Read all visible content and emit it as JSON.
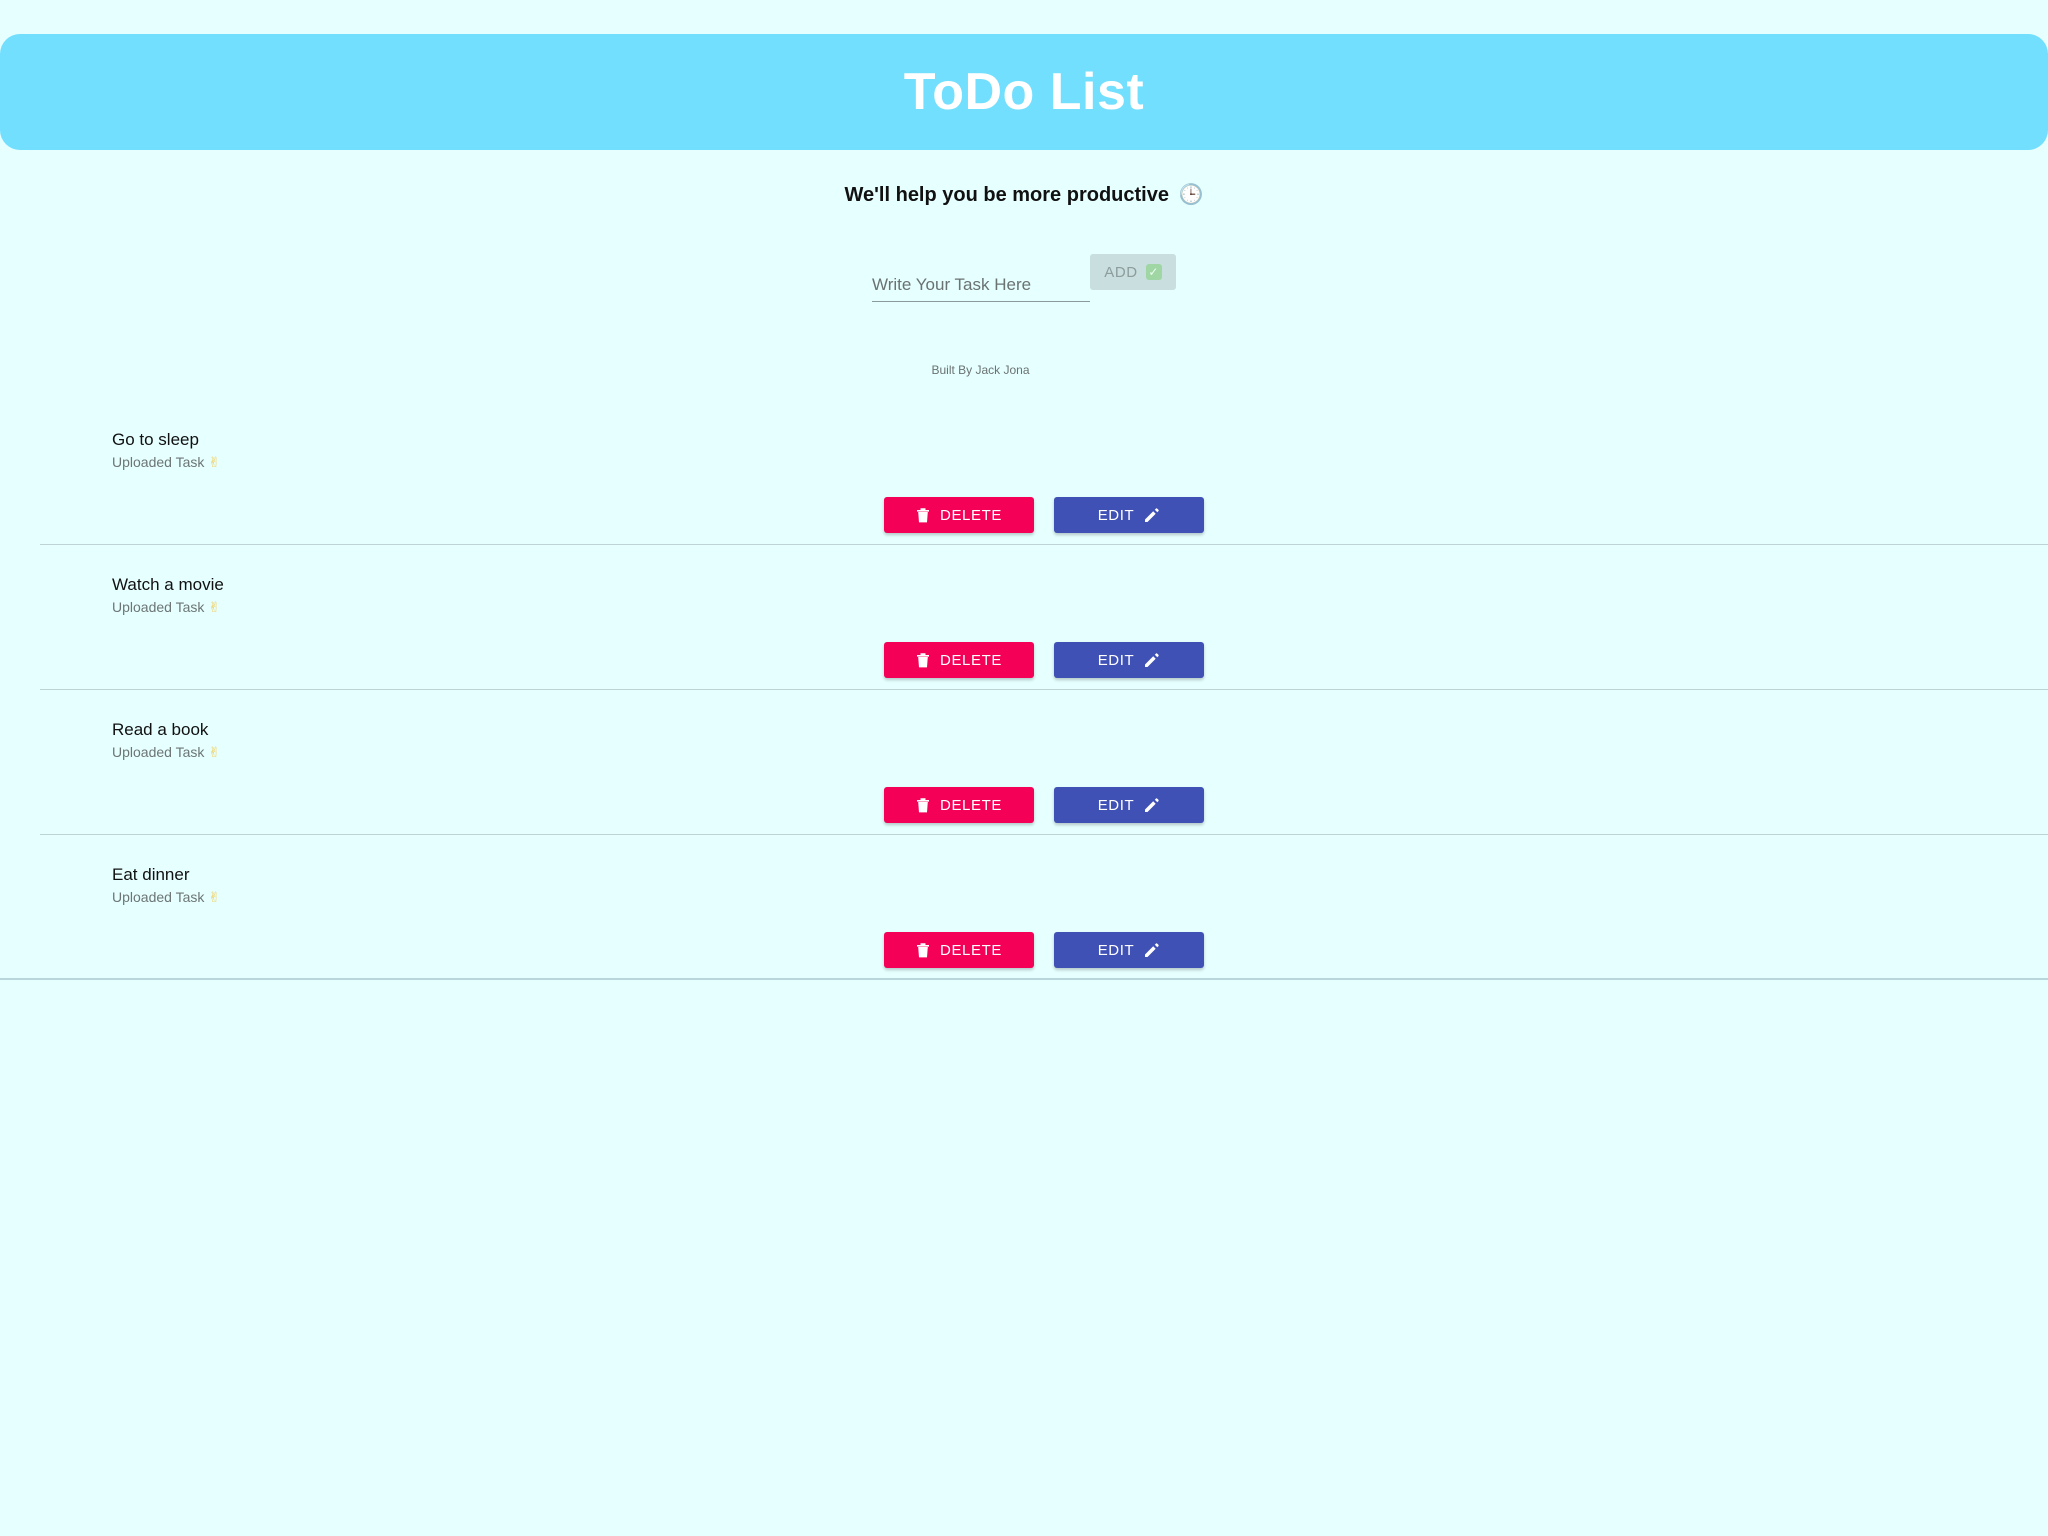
{
  "header": {
    "title": "ToDo List"
  },
  "tagline": {
    "text": "We'll help you be more productive",
    "icon": "🕒"
  },
  "form": {
    "input_placeholder": "Write Your Task Here",
    "input_value": "",
    "add_label": "ADD",
    "add_icon": "✓"
  },
  "credit": "Built By Jack Jona",
  "tasks": [
    {
      "title": "Go to sleep",
      "subtitle": "Uploaded Task",
      "sub_icon": "✌",
      "delete_label": "DELETE",
      "edit_label": "EDIT"
    },
    {
      "title": "Watch a movie",
      "subtitle": "Uploaded Task",
      "sub_icon": "✌",
      "delete_label": "DELETE",
      "edit_label": "EDIT"
    },
    {
      "title": "Read a book",
      "subtitle": "Uploaded Task",
      "sub_icon": "✌",
      "delete_label": "DELETE",
      "edit_label": "EDIT"
    },
    {
      "title": "Eat dinner",
      "subtitle": "Uploaded Task",
      "sub_icon": "✌",
      "delete_label": "DELETE",
      "edit_label": "EDIT"
    }
  ],
  "colors": {
    "background": "#e6ffff",
    "header": "#72dffe",
    "delete": "#f50057",
    "edit": "#3f51b5",
    "add_disabled": "#c9dede"
  }
}
